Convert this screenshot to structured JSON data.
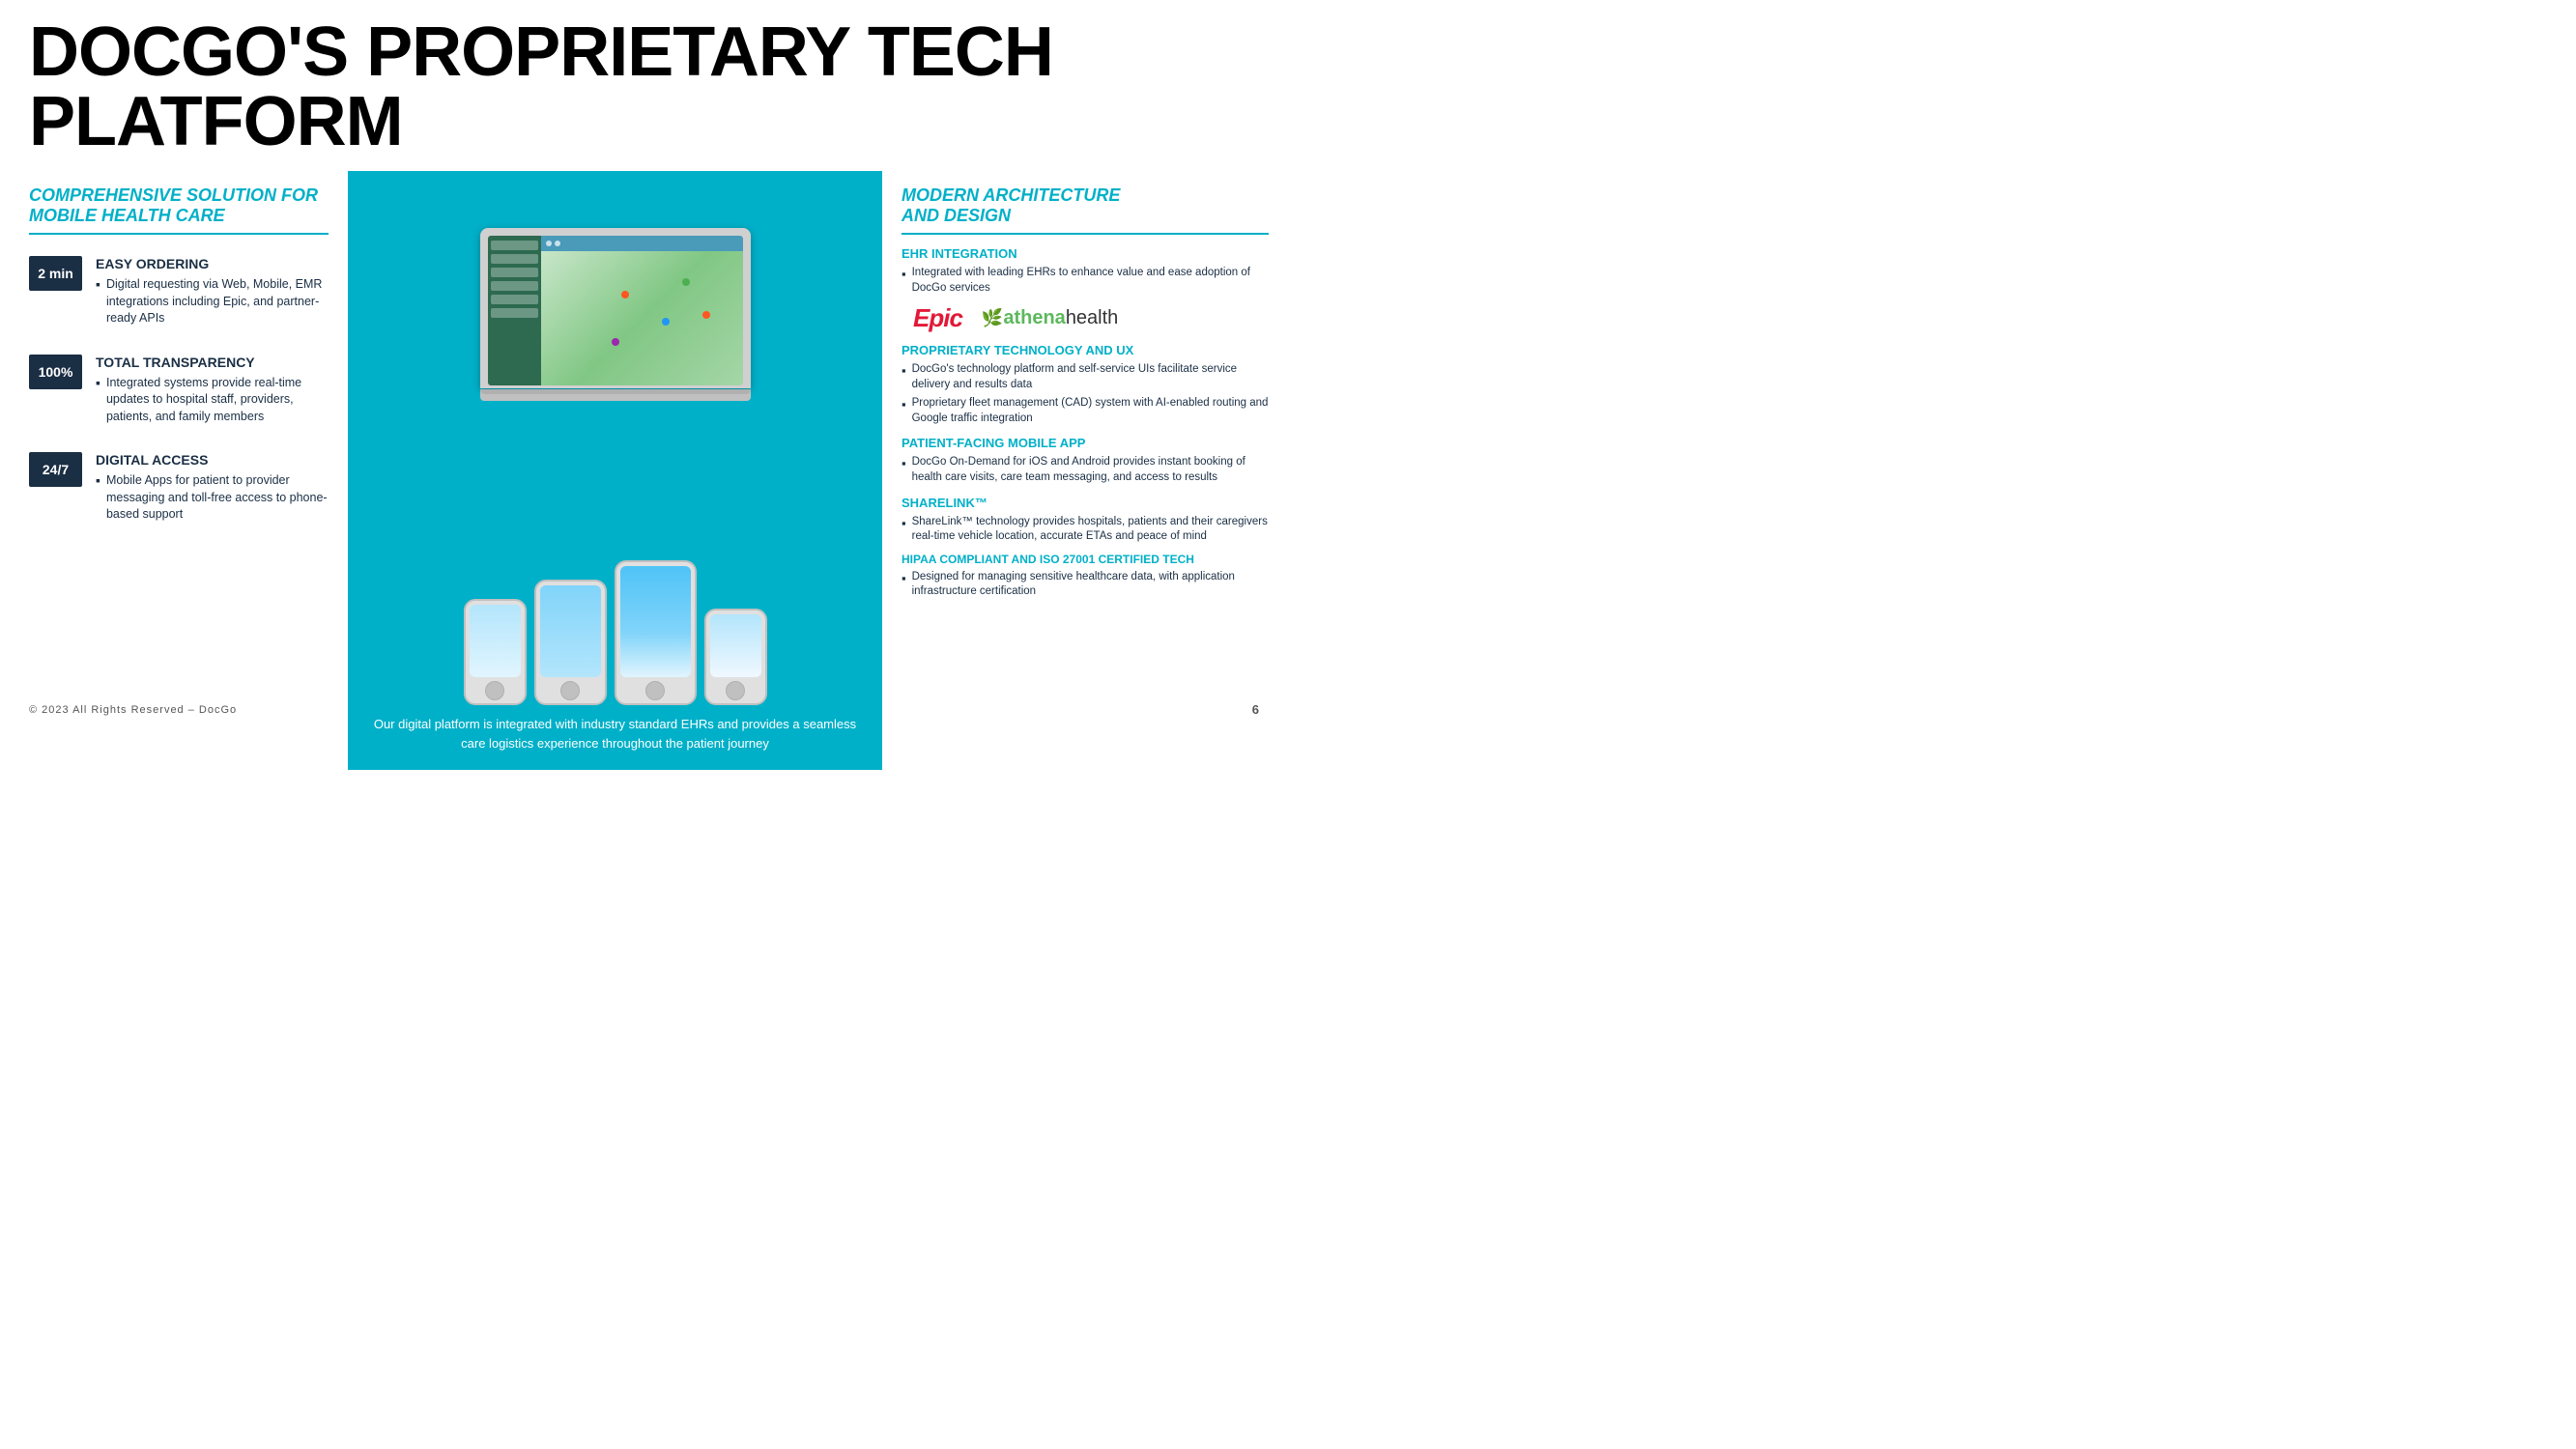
{
  "header": {
    "title": "DOCGO'S PROPRIETARY TECH PLATFORM"
  },
  "left": {
    "section_heading": "COMPREHENSIVE SOLUTION FOR MOBILE HEALTH CARE",
    "features": [
      {
        "badge": "2 min",
        "title": "EASY ORDERING",
        "description": "Digital requesting via Web, Mobile, EMR integrations including Epic, and partner-ready APIs"
      },
      {
        "badge": "100%",
        "title": "TOTAL TRANSPARENCY",
        "description": "Integrated systems provide real-time updates to hospital staff, providers, patients, and family members"
      },
      {
        "badge": "24/7",
        "title": "DIGITAL ACCESS",
        "description": "Mobile Apps for patient to provider messaging and toll-free access to phone-based support"
      }
    ]
  },
  "center": {
    "caption": "Our digital platform is integrated with industry standard EHRs\nand provides a seamless care logistics\nexperience throughout the patient\njourney"
  },
  "right": {
    "section_heading": "MODERN ARCHITECTURE\nAND DESIGN",
    "sections": [
      {
        "title": "EHR INTEGRATION",
        "bullets": [
          "Integrated with leading EHRs to enhance value and ease adoption of DocGo services"
        ]
      },
      {
        "title": "PROPRIETARY TECHNOLOGY AND UX",
        "bullets": [
          "DocGo's technology platform and self-service UIs facilitate service delivery and results data",
          "Proprietary fleet management (CAD) system with AI-enabled routing and Google traffic integration"
        ]
      },
      {
        "title": "PATIENT-FACING MOBILE APP",
        "bullets": [
          "DocGo On-Demand for iOS and Android provides instant booking of health care visits, care team messaging, and access to results"
        ]
      },
      {
        "title": "SHARELINK™",
        "bullets": [
          "ShareLink™ technology provides hospitals, patients and their caregivers real-time vehicle location, accurate ETAs and peace of mind"
        ]
      },
      {
        "title": "HIPAA COMPLIANT AND ISO 27001 CERTIFIED TECH",
        "bullets": [
          "Designed for managing sensitive healthcare data, with application infrastructure certification"
        ]
      }
    ]
  },
  "footer": {
    "copyright": "© 2023 All Rights Reserved – DocGo",
    "page_number": "6"
  }
}
